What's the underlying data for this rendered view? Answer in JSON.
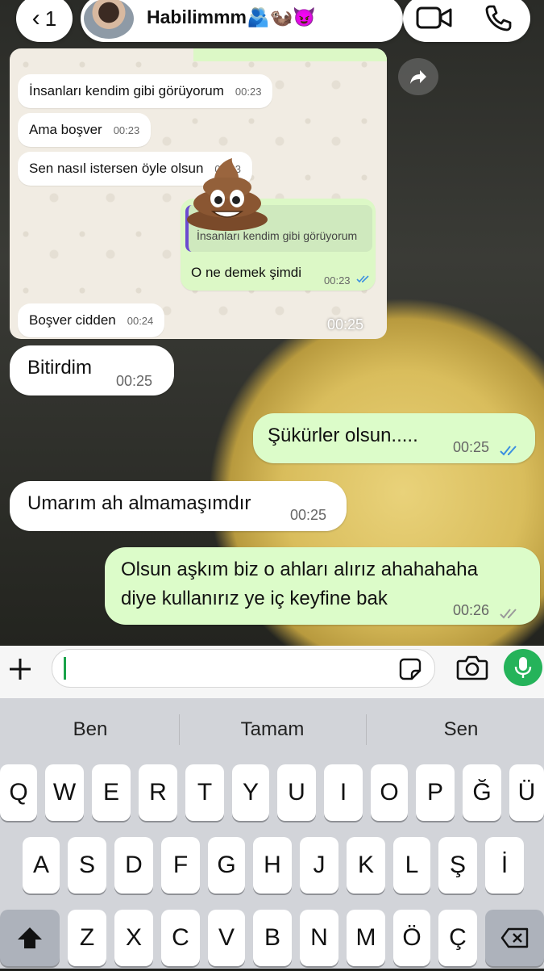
{
  "header": {
    "back_count": "1",
    "contact_name": "Habilimmm🫂🦦😈"
  },
  "screenshot": {
    "messages": [
      {
        "text": "İnsanları kendim gibi görüyorum",
        "time": "00:23"
      },
      {
        "text": "Ama boşver",
        "time": "00:23"
      },
      {
        "text": "Sen nasıl istersen öyle olsun",
        "time": "00:23"
      }
    ],
    "reply": {
      "quoted": "İnsanları kendim gibi görüyorum",
      "text": "O ne demek şimdi",
      "time": "00:23"
    },
    "last": {
      "text": "Boşver cidden",
      "time": "00:24"
    },
    "image_time": "00:25"
  },
  "messages": [
    {
      "side": "in",
      "text": "Bitirdim",
      "time": "00:25"
    },
    {
      "side": "out",
      "text": "Şükürler olsun.....",
      "time": "00:25",
      "ticks": "read"
    },
    {
      "side": "in",
      "text": "Umarım ah almamaşımdır",
      "time": "00:25"
    },
    {
      "side": "out",
      "line1": "Olsun aşkım biz o ahları alırız ahahahaha",
      "line2": "diye kullanırız ye iç keyfine bak",
      "time": "00:26",
      "ticks": "delivered"
    }
  ],
  "input": {
    "value": "",
    "placeholder": ""
  },
  "keyboard": {
    "suggestions": [
      "Ben",
      "Tamam",
      "Sen"
    ],
    "row1": [
      "Q",
      "W",
      "E",
      "R",
      "T",
      "Y",
      "U",
      "I",
      "O",
      "P",
      "Ğ",
      "Ü"
    ],
    "row2": [
      "A",
      "S",
      "D",
      "F",
      "G",
      "H",
      "J",
      "K",
      "L",
      "Ş",
      "İ"
    ],
    "row3": [
      "Z",
      "X",
      "C",
      "V",
      "B",
      "N",
      "M",
      "Ö",
      "Ç"
    ]
  },
  "colors": {
    "outgoing_bubble": "#dcfcc9",
    "incoming_bubble": "#ffffff",
    "read_ticks": "#3b8fe0",
    "mic_button": "#25b35a"
  }
}
